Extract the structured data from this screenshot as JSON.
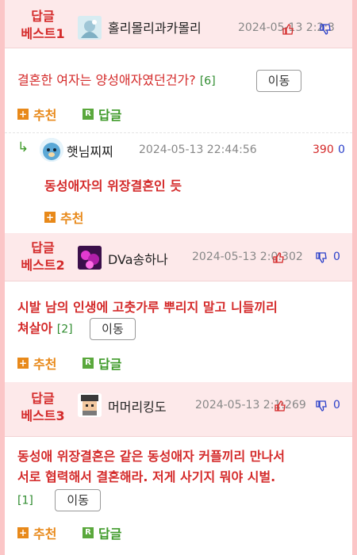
{
  "comments": [
    {
      "best_label": [
        "답글",
        "베스트1"
      ],
      "nickname": "홀리몰리과카몰리",
      "date_overlap": "2024-05-13 2:2:3",
      "text": "결혼한 여자는 양성애자였던건가?",
      "reply_count": "[6]",
      "move_label": "이동",
      "recommend_label": "추천",
      "reply_label": "답글"
    },
    {
      "nickname": "햇님찌찌",
      "date": "2024-05-13 22:44:56",
      "upvotes": "390",
      "downvotes": "0",
      "text": "동성애자의 위장결혼인 듯",
      "recommend_label": "추천"
    },
    {
      "best_label": [
        "답글",
        "베스트2"
      ],
      "nickname": "DVa송하나",
      "date_overlap": "2024-05-13 2:0:302",
      "downvotes": "0",
      "text_lines": [
        "시발 남의 인생에 고춧가루 뿌리지 말고 니들끼리",
        "쳐살아"
      ],
      "reply_count": "[2]",
      "move_label": "이동",
      "recommend_label": "추천",
      "reply_label": "답글"
    },
    {
      "best_label": [
        "답글",
        "베스트3"
      ],
      "nickname": "머머리킹도",
      "date_overlap": "2024-05-13 2:1:269",
      "downvotes": "0",
      "text_lines": [
        "동성애 위장결혼은 같은 동성애자 커플끼리 만나서",
        "서로 협력해서 결혼해라. 저게 사기지 뭐야 시벌."
      ],
      "reply_count": "[1]",
      "move_label": "이동",
      "recommend_label": "추천",
      "reply_label": "답글"
    }
  ],
  "colors": {
    "best_red": "#d42a2a",
    "downvote_blue": "#2a3fc9",
    "recommend_orange": "#e8891a",
    "reply_green": "#3f9a2a",
    "header_pink": "#fde9ea",
    "frame_pink": "#fbc6c7"
  },
  "icons": [
    "thumbs-up-icon",
    "thumbs-down-icon",
    "plus-icon",
    "reply-r-icon",
    "reply-arrow-icon",
    "avatar-image"
  ]
}
